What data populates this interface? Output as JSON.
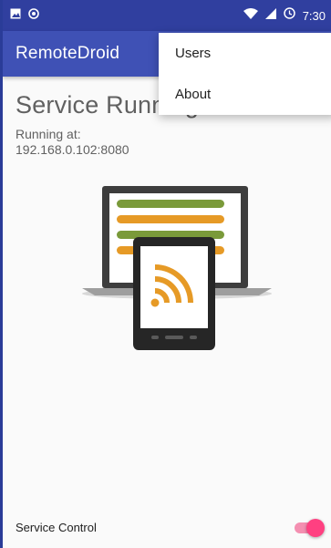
{
  "status_bar": {
    "time": "7:30",
    "icons": [
      "image-icon",
      "sync-icon",
      "wifi-icon",
      "signal-icon",
      "alarm-icon"
    ]
  },
  "app_bar": {
    "title": "RemoteDroid",
    "background": "#3f51b5"
  },
  "overflow_menu": {
    "items": [
      {
        "label": "Users"
      },
      {
        "label": "About"
      }
    ]
  },
  "main": {
    "status_title": "Service Running",
    "running_label": "Running at:",
    "running_address": "192.168.0.102:8080"
  },
  "service_control": {
    "label": "Service Control",
    "enabled": true,
    "accent": "#ff4081"
  }
}
